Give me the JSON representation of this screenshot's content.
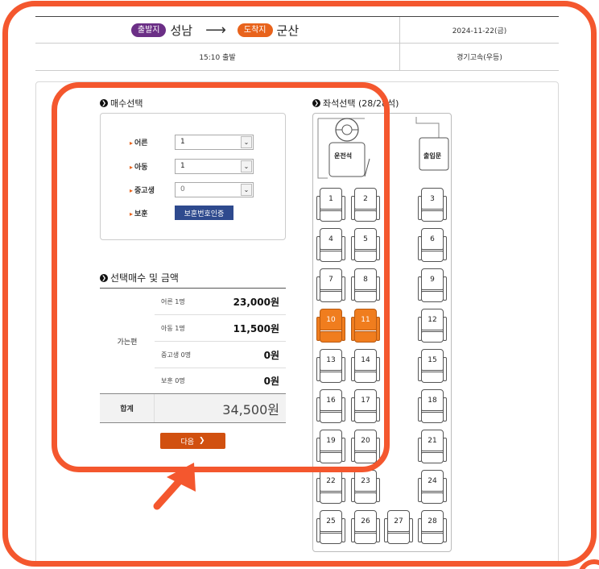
{
  "route": {
    "departure_badge": "출발지",
    "departure_city": "성남",
    "arrow": "⟶",
    "arrival_badge": "도착지",
    "arrival_city": "군산",
    "date": "2024-11-22(금)",
    "departure_time": "15:10 출발",
    "bus_company": "경기고속(우등)"
  },
  "count_select": {
    "title": "매수선택",
    "rows": [
      {
        "label": "어른",
        "value": "1"
      },
      {
        "label": "아동",
        "value": "1"
      },
      {
        "label": "중고생",
        "value": "0"
      }
    ],
    "veteran_label": "보훈",
    "veteran_button": "보훈번호인증"
  },
  "seat_select": {
    "title": "좌석선택 (28/28석)",
    "driver_label": "운전석",
    "door_label": "출입문",
    "seats": [
      "1",
      "2",
      "3",
      "4",
      "5",
      "6",
      "7",
      "8",
      "9",
      "10",
      "11",
      "12",
      "13",
      "14",
      "15",
      "16",
      "17",
      "18",
      "19",
      "20",
      "21",
      "22",
      "23",
      "24",
      "25",
      "26",
      "27",
      "28"
    ],
    "selected": [
      "10",
      "11"
    ],
    "colors": {
      "selected": "#f07d1e"
    }
  },
  "price": {
    "title": "선택매수 및 금액",
    "direction": "가는편",
    "rows": [
      {
        "label": "어른 1명",
        "amount": "23,000원"
      },
      {
        "label": "아동 1명",
        "amount": "11,500원"
      },
      {
        "label": "중고생 0명",
        "amount": "0원"
      },
      {
        "label": "보훈 0명",
        "amount": "0원"
      }
    ],
    "total_label": "합계",
    "total_amount": "34,500원"
  },
  "next_button": {
    "label": "다음",
    "chevron": "❯"
  },
  "colors": {
    "departure_badge": "#6b2f86",
    "arrival_badge": "#e8631c",
    "veteran_button": "#2e4a8e",
    "next_button": "#d1500f",
    "annotation": "#f4572e"
  }
}
